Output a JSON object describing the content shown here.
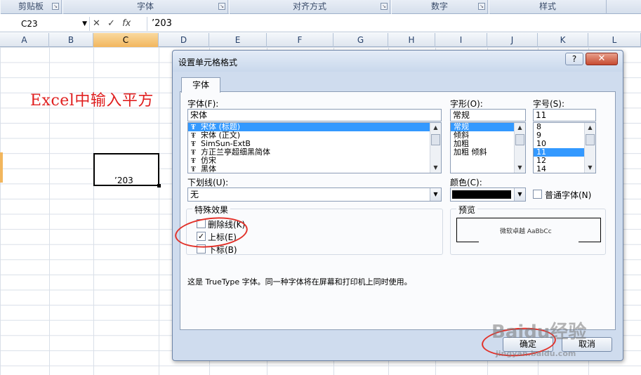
{
  "ribbon": {
    "groups": [
      "剪贴板",
      "字体",
      "对齐方式",
      "数字",
      "样式"
    ]
  },
  "formula_bar": {
    "name_box": "C23",
    "cancel_icon": "✕",
    "enter_icon": "✓",
    "fx_label": "fx",
    "value": "’203"
  },
  "columns": [
    "A",
    "B",
    "C",
    "D",
    "E",
    "F",
    "G",
    "H",
    "I",
    "J",
    "K",
    "L"
  ],
  "sheet": {
    "title_text": "Excel中输入平方",
    "active_cell_value": "’203"
  },
  "dialog": {
    "title": "设置单元格格式",
    "help_button": "?",
    "close_button": "✕",
    "tab": "字体",
    "font_label": "字体(F):",
    "font_value": "宋体",
    "font_list": [
      "宋体 (标题)",
      "宋体 (正文)",
      "SimSun-ExtB",
      "方正兰亭超细黑简体",
      "仿宋",
      "黑体"
    ],
    "style_label": "字形(O):",
    "style_value": "常规",
    "style_list": [
      "常规",
      "倾斜",
      "加粗",
      "加粗 倾斜"
    ],
    "size_label": "字号(S):",
    "size_value": "11",
    "size_list": [
      "8",
      "9",
      "10",
      "11",
      "12",
      "14"
    ],
    "underline_label": "下划线(U):",
    "underline_value": "无",
    "color_label": "颜色(C):",
    "color_value": "#000000",
    "normal_font_label": "普通字体(N)",
    "effects_label": "特殊效果",
    "strikethrough_label": "删除线(K)",
    "superscript_label": "上标(E)",
    "subscript_label": "下标(B)",
    "superscript_checked": true,
    "preview_label": "预览",
    "preview_text": "微软卓越 AaBbCc",
    "info_text": "这是 TrueType 字体。同一种字体将在屏幕和打印机上同时使用。",
    "ok_label": "确定",
    "cancel_label": "取消"
  },
  "watermark": {
    "brand": "Baidu经验",
    "url": "jingyan.baidu.com"
  },
  "colors": {
    "annotation_red": "#e2322a",
    "selection_blue": "#3399ff"
  }
}
